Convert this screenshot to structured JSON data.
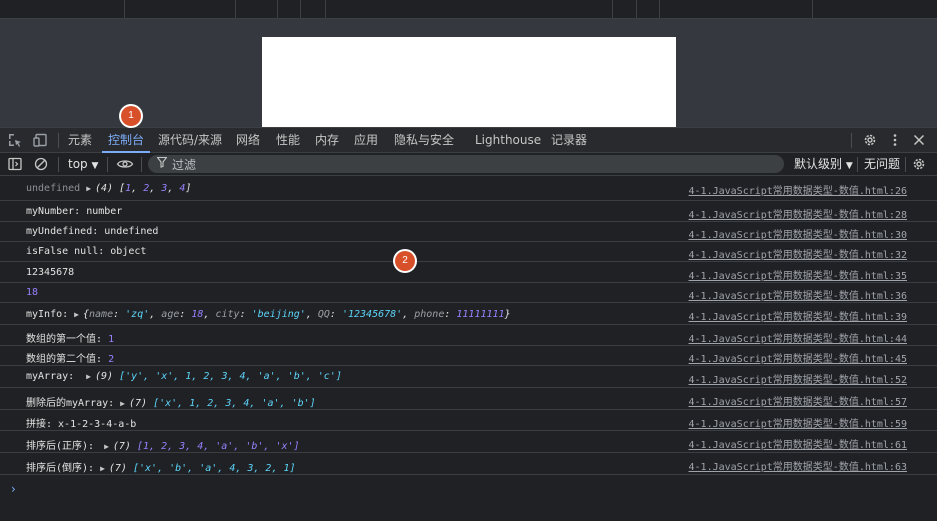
{
  "tabs": {
    "elements": "元素",
    "console": "控制台",
    "sources": "源代码/来源",
    "network": "网络",
    "performance": "性能",
    "memory": "内存",
    "application": "应用",
    "privacy": "隐私与安全",
    "lighthouse": "Lighthouse",
    "recorder": "记录器"
  },
  "toolbar": {
    "context": "top",
    "filter_placeholder": "过滤",
    "levels": "默认级别",
    "issues": "无问题"
  },
  "rows": [
    {
      "src": "4-1.JavaScript常用数据类型-数值.html:26"
    },
    {
      "msg": "myNumber: number",
      "src": "4-1.JavaScript常用数据类型-数值.html:28"
    },
    {
      "msg": "myUndefined: undefined",
      "src": "4-1.JavaScript常用数据类型-数值.html:30"
    },
    {
      "msg": "isFalse null: object",
      "src": "4-1.JavaScript常用数据类型-数值.html:32"
    },
    {
      "msg": "12345678",
      "src": "4-1.JavaScript常用数据类型-数值.html:35"
    },
    {
      "msg": "18",
      "src": "4-1.JavaScript常用数据类型-数值.html:36"
    },
    {
      "src": "4-1.JavaScript常用数据类型-数值.html:39"
    },
    {
      "src": "4-1.JavaScript常用数据类型-数值.html:44"
    },
    {
      "src": "4-1.JavaScript常用数据类型-数值.html:45"
    },
    {
      "src": "4-1.JavaScript常用数据类型-数值.html:52"
    },
    {
      "src": "4-1.JavaScript常用数据类型-数值.html:57"
    },
    {
      "msg": "拼接:  x-1-2-3-4-a-b",
      "src": "4-1.JavaScript常用数据类型-数值.html:59"
    },
    {
      "src": "4-1.JavaScript常用数据类型-数值.html:61"
    },
    {
      "src": "4-1.JavaScript常用数据类型-数值.html:63"
    }
  ],
  "r1": {
    "label": "undefined",
    "count": "(4)",
    "items": [
      "1",
      "2",
      "3",
      "4"
    ]
  },
  "r7": {
    "label": "myInfo:",
    "name": "'zq'",
    "age": "18",
    "city": "'beijing'",
    "qq": "'12345678'",
    "phone": "11111111"
  },
  "r8": {
    "label": "数组的第一个值:",
    "val": "1"
  },
  "r9": {
    "label": "数组的第二个值:",
    "val": "2"
  },
  "r10": {
    "label": "myArray:",
    "count": "(9)",
    "body": "['y', 'x', 1, 2, 3, 4, 'a', 'b', 'c']"
  },
  "r11": {
    "label": "删除后的myArray:",
    "count": "(7)",
    "body": "['x', 1, 2, 3, 4, 'a', 'b']"
  },
  "r13": {
    "label": "排序后(正序):",
    "count": "(7)",
    "body": "[1, 2, 3, 4, 'a', 'b', 'x']"
  },
  "r14": {
    "label": "排序后(倒序):",
    "count": "(7)",
    "body": "['x', 'b', 'a', 4, 3, 2, 1]"
  },
  "badges": {
    "one": "1",
    "two": "2"
  },
  "prompt_symbol": "›",
  "icons": [
    "inspect-icon",
    "device-toggle-icon",
    "settings-icon",
    "more-icon",
    "close-icon",
    "sidebar-toggle-icon",
    "clear-console-icon",
    "eye-icon",
    "filter-icon",
    "gear-icon"
  ]
}
